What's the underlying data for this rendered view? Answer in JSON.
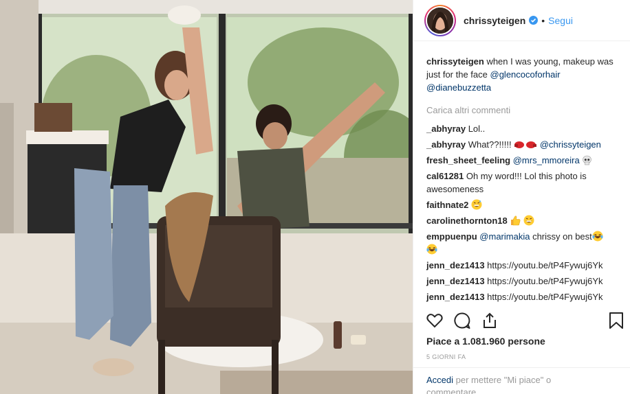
{
  "header": {
    "username": "chrissyteigen",
    "dot": "•",
    "follow_label": "Segui"
  },
  "caption": {
    "username": "chrissyteigen",
    "text": " when I was young, makeup was just for the face ",
    "mention1": "@glencocoforhair",
    "mention2": "@dianebuzzetta"
  },
  "load_more": "Carica altri commenti",
  "comments": [
    {
      "username": "_abhyray",
      "text": " Lol.."
    },
    {
      "username": "_abhyray",
      "text": " What??!!!!!",
      "emoji": "boxing-glove",
      "mention": "@chrissyteigen"
    },
    {
      "username": "fresh_sheet_feeling",
      "mention": "@mrs_mmoreira",
      "emoji": "skull"
    },
    {
      "username": "cal61281",
      "text": " Oh my word!!! Lol this photo is awesomeness"
    },
    {
      "username": "faithnate2",
      "emoji": "grinning-sweat"
    },
    {
      "username": "carolinethornton18",
      "emoji": "thumbs-up-and-grinning-sweat"
    },
    {
      "username": "emppuenpu",
      "mention": "@marimakia",
      "text": " chrissy on best",
      "emoji": "laughing-tears"
    },
    {
      "username": "jenn_dez1413",
      "text": " https://youtu.be/tP4Fywuj6Yk"
    },
    {
      "username": "jenn_dez1413",
      "text": " https://youtu.be/tP4Fywuj6Yk"
    },
    {
      "username": "jenn_dez1413",
      "text": " https://youtu.be/tP4Fywuj6Yk"
    }
  ],
  "icons": [
    "heart-icon",
    "comment-icon",
    "share-icon",
    "bookmark-icon",
    "verified-badge-icon"
  ],
  "likes": "Piace a 1.081.960 persone",
  "time_ago": "5 GIORNI FA",
  "login_prompt": {
    "link": "Accedi",
    "text": " per mettere \"Mi piace\" o commentare."
  },
  "colors": {
    "link": "#3897f0",
    "mention": "#003569",
    "muted": "#999999",
    "text": "#262626"
  }
}
